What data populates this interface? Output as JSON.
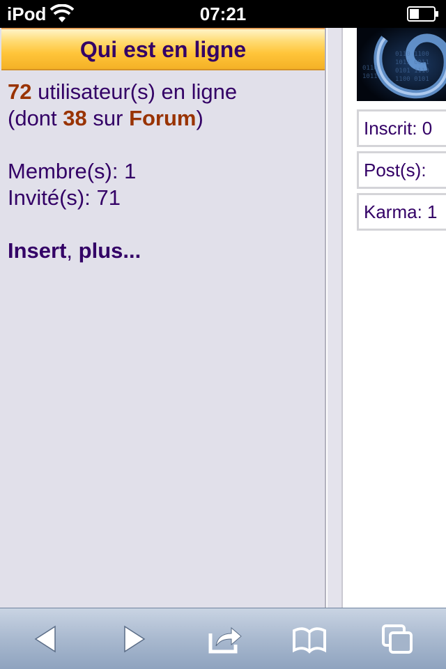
{
  "status_bar": {
    "carrier": "iPod",
    "time": "07:21"
  },
  "who_online": {
    "header": "Qui est en ligne",
    "users_count": "72",
    "users_text": " utilisateur(s) en ligne",
    "dont_open": "(dont ",
    "forum_count": "38",
    "sur_text": " sur ",
    "forum_label": "Forum",
    "dont_close": ")",
    "members_label": "Membre(s): 1",
    "guests_label": "Invité(s): 71",
    "member_link": "Insert",
    "separator": ", ",
    "more_link": "plus..."
  },
  "profile": {
    "inscrit_label": "Inscrit: 0",
    "posts_label": "Post(s):",
    "karma_label": "Karma: 1"
  },
  "toolbar": {
    "icons": [
      "back-icon",
      "forward-icon",
      "share-icon",
      "bookmarks-icon",
      "tabs-icon"
    ]
  },
  "colors": {
    "text": "#330066",
    "highlight": "#993300",
    "header_gradient": "#ffc53a",
    "panel_bg": "#e1e0ea"
  }
}
